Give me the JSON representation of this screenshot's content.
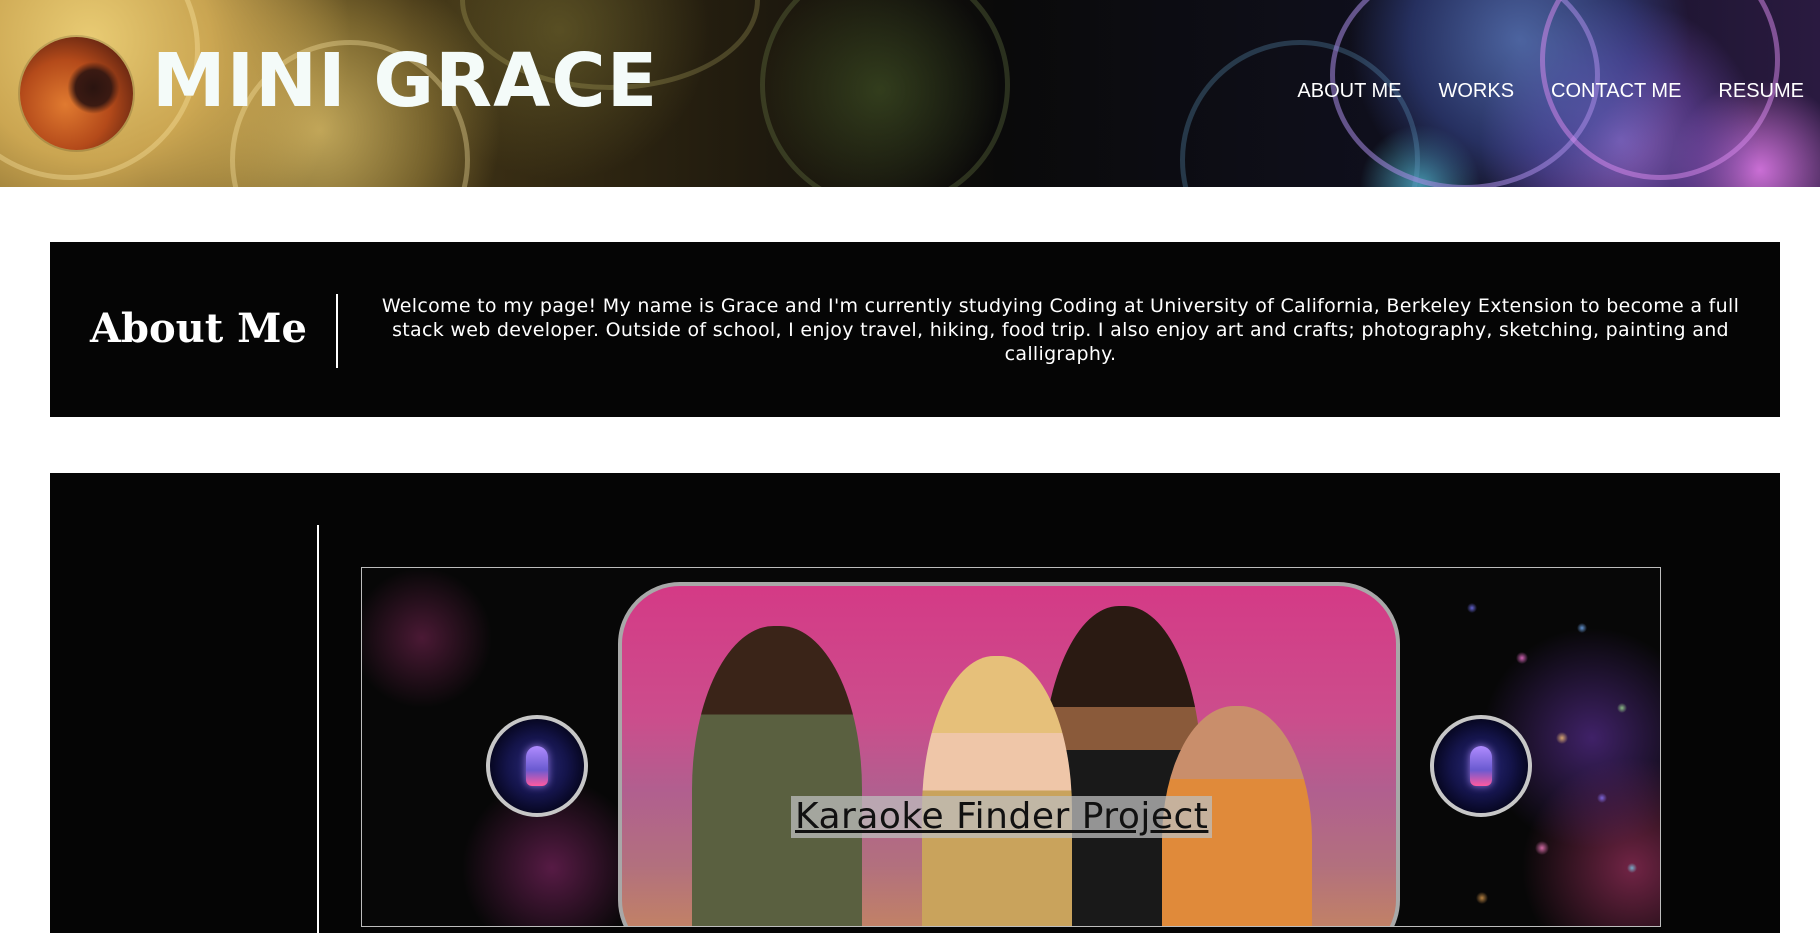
{
  "header": {
    "site_title": "MINI GRACE",
    "nav": {
      "about": "ABOUT ME",
      "works": "WORKS",
      "contact": "CONTACT ME",
      "resume": "RESUME"
    }
  },
  "about": {
    "title": "About Me",
    "text": "Welcome to my page! My name is Grace and I'm currently studying Coding at University of California, Berkeley Extension to become a full stack web developer. Outside of school, I enjoy travel, hiking, food trip. I also enjoy art and crafts; photography, sketching, painting and calligraphy."
  },
  "works": {
    "project_title": "Karaoke Finder Project"
  },
  "colors": {
    "section_bg": "#050505",
    "page_bg": "#ffffff",
    "title_text": "#f4fbf9"
  }
}
